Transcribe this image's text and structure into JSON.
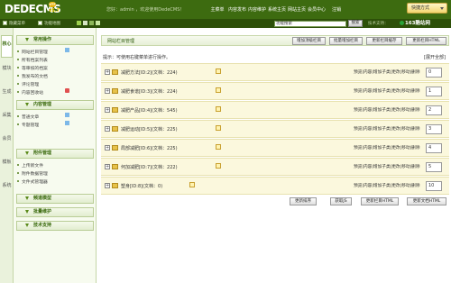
{
  "logo": {
    "text": "DEDECMS",
    "version": "v5.7",
    "badge": "UTF"
  },
  "header": {
    "welcome": "您好：admin ，欢迎使用DedeCMS！",
    "nav": [
      "主菜单",
      "内容发布",
      "内容维护",
      "系统主页",
      "网站主页",
      "会员中心",
      "注销"
    ],
    "quick_menu": "快捷方式"
  },
  "subbar": {
    "hide_menu": "隐藏菜单",
    "sitemap": "功能地图",
    "search_value": "功能搜索",
    "search_button": "搜索",
    "tech_support": "技术支持：",
    "brand": "163酷站网"
  },
  "vtabs": [
    "核心",
    "模块",
    "生成",
    "采集",
    "会员",
    "模板",
    "系统"
  ],
  "sidebar": {
    "sections": [
      {
        "title": "常用操作",
        "items": [
          "网站栏目管理",
          "所有档案列表",
          "等审核的档案",
          "我发布的文档",
          "评论管理",
          "内容回收站"
        ]
      },
      {
        "title": "内容管理",
        "items": [
          "普通文章",
          "专题管理"
        ]
      },
      {
        "title": "附件管理",
        "items": [
          "上传新文件",
          "附件数据管理",
          "文件式管理器"
        ]
      },
      {
        "title": "频道模型",
        "items": []
      },
      {
        "title": "批量维护",
        "items": []
      },
      {
        "title": "技术支持",
        "items": []
      }
    ]
  },
  "main": {
    "title": "网站栏目管理",
    "top_buttons": [
      "增加顶级栏目",
      "批量增加栏目",
      "更新栏目缓存",
      "更新栏目HTML"
    ],
    "tip": "提示：可使用右键菜单进行操作。",
    "expand_all": "[展开全部]",
    "ops": "预览|内容|增加子类|更改|移动|删除",
    "rows": [
      {
        "name": "减肥方法[ID:2](文档：224)",
        "order": "0"
      },
      {
        "name": "减肥食谱[ID:3](文档：224)",
        "order": "1"
      },
      {
        "name": "减肥产品[ID:4](文档：545)",
        "order": "2"
      },
      {
        "name": "减肥运动[ID:5](文档：225)",
        "order": "3"
      },
      {
        "name": "局部减肥[ID:6](文档：225)",
        "order": "4"
      },
      {
        "name": "何加减肥[ID:7](文档：222)",
        "order": "5"
      },
      {
        "name": "塑身[ID:8](文档：0)",
        "order": "10"
      }
    ],
    "bottom_buttons": [
      "更新排序",
      "获取JS",
      "更新栏目HTML",
      "更新文档HTML"
    ]
  },
  "colors": {
    "header": "#3d6b10",
    "subbar": "#2d5009",
    "row_bg": "#fbf8dd",
    "accent": "#3a6a0d"
  }
}
